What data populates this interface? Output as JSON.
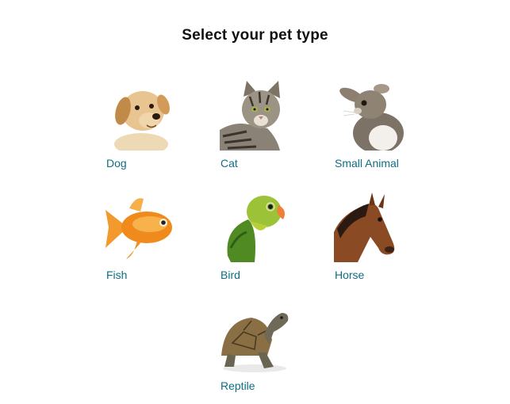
{
  "page": {
    "title": "Select your pet type"
  },
  "pets": [
    {
      "label": "Dog",
      "icon": "dog-photo"
    },
    {
      "label": "Cat",
      "icon": "cat-photo"
    },
    {
      "label": "Small Animal",
      "icon": "rabbit-photo"
    },
    {
      "label": "Fish",
      "icon": "goldfish-photo"
    },
    {
      "label": "Bird",
      "icon": "parrot-photo"
    },
    {
      "label": "Horse",
      "icon": "horse-photo"
    },
    {
      "label": "Reptile",
      "icon": "turtle-photo"
    }
  ],
  "colors": {
    "title": "#0f1111",
    "link": "#0e6e83",
    "background": "#ffffff"
  }
}
